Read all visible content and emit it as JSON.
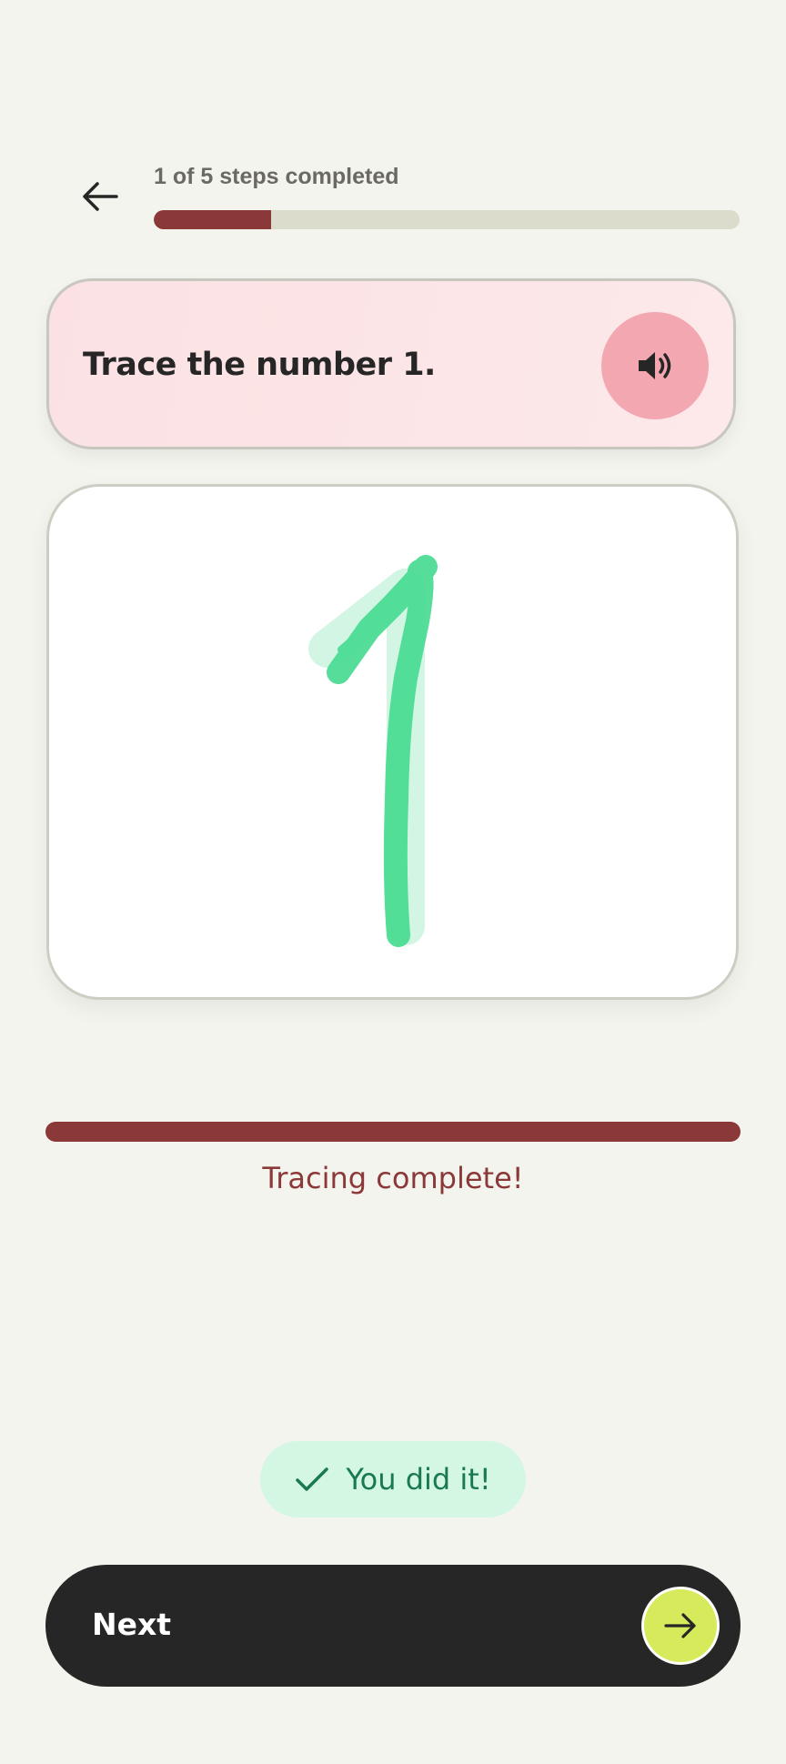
{
  "header": {
    "back_icon": "arrow-left-icon",
    "progress_text": "1 of 5 steps completed",
    "steps_completed": 1,
    "steps_total": 5,
    "progress_color": "#8b3838"
  },
  "prompt": {
    "text": "Trace the number 1.",
    "audio_icon": "speaker-icon",
    "card_color": "#fde6e8",
    "audio_button_color": "#f3a7b0"
  },
  "canvas": {
    "guide_number": "1",
    "guide_color": "#d3f5e3",
    "stroke_color": "#4cdc94"
  },
  "tracing": {
    "progress_fraction": 1.0,
    "status_text": "Tracing complete!",
    "bar_color": "#8b3838"
  },
  "success": {
    "icon": "check-icon",
    "text": "You did it!",
    "background": "#d3f7e3",
    "text_color": "#1a7a4f"
  },
  "next_button": {
    "label": "Next",
    "icon": "arrow-right-icon",
    "arrow_circle_color": "#d7ea5c"
  }
}
